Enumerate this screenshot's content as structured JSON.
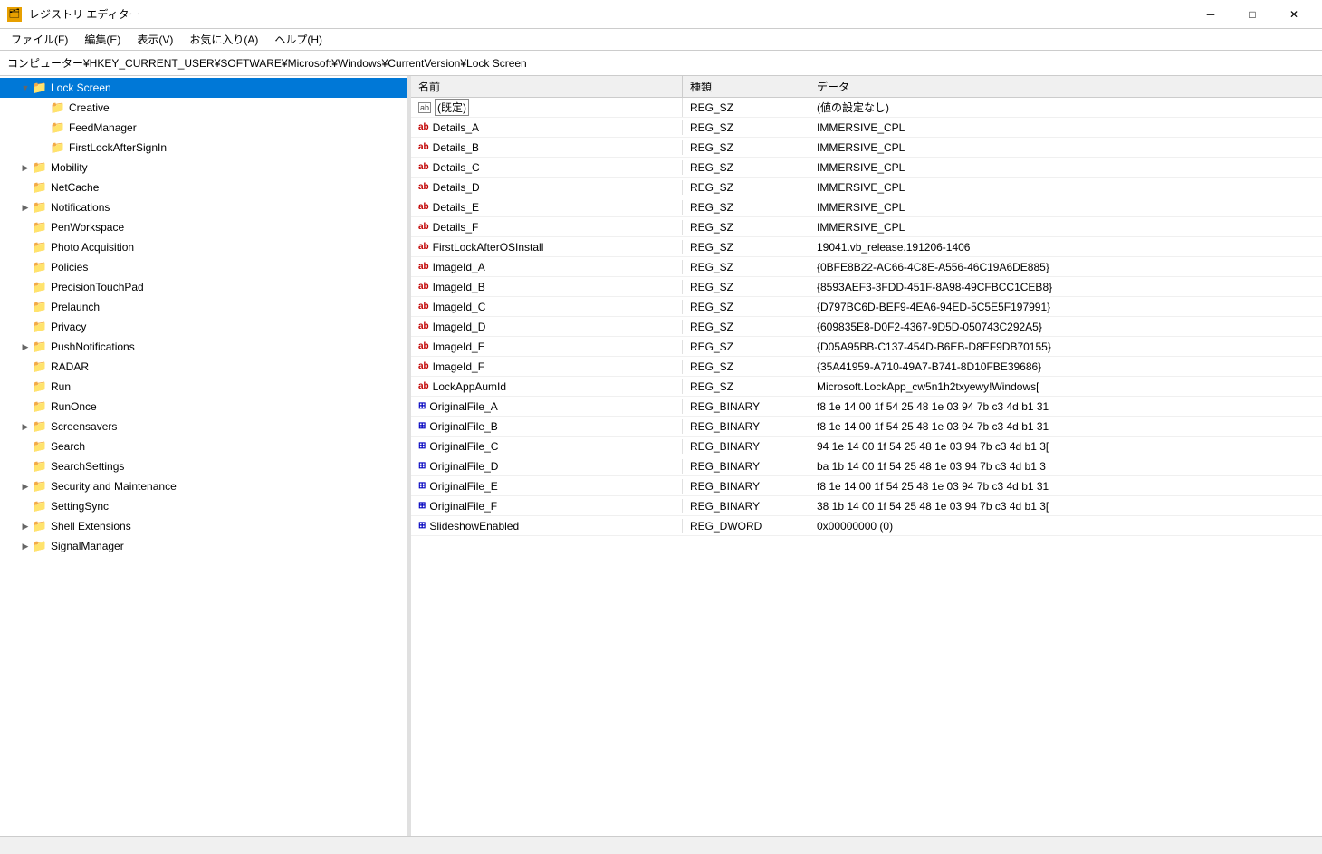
{
  "titleBar": {
    "icon": "🗂",
    "title": "レジストリ エディター",
    "minBtn": "─",
    "maxBtn": "□",
    "closeBtn": "✕"
  },
  "menuBar": {
    "items": [
      {
        "label": "ファイル(F)"
      },
      {
        "label": "編集(E)"
      },
      {
        "label": "表示(V)"
      },
      {
        "label": "お気に入り(A)"
      },
      {
        "label": "ヘルプ(H)"
      }
    ]
  },
  "addressBar": {
    "path": "コンピューター¥HKEY_CURRENT_USER¥SOFTWARE¥Microsoft¥Windows¥CurrentVersion¥Lock Screen"
  },
  "treePanel": {
    "header": "名前",
    "items": [
      {
        "label": "Lock Screen",
        "indent": 1,
        "selected": true,
        "expanded": true,
        "hasExpand": true
      },
      {
        "label": "Creative",
        "indent": 2,
        "selected": false,
        "expanded": false,
        "hasExpand": false
      },
      {
        "label": "FeedManager",
        "indent": 2,
        "selected": false,
        "expanded": false,
        "hasExpand": false
      },
      {
        "label": "FirstLockAfterSignIn",
        "indent": 2,
        "selected": false,
        "expanded": false,
        "hasExpand": false
      },
      {
        "label": "Mobility",
        "indent": 1,
        "selected": false,
        "expanded": false,
        "hasExpand": true
      },
      {
        "label": "NetCache",
        "indent": 1,
        "selected": false,
        "expanded": false,
        "hasExpand": false
      },
      {
        "label": "Notifications",
        "indent": 1,
        "selected": false,
        "expanded": false,
        "hasExpand": true
      },
      {
        "label": "PenWorkspace",
        "indent": 1,
        "selected": false,
        "expanded": false,
        "hasExpand": false
      },
      {
        "label": "Photo Acquisition",
        "indent": 1,
        "selected": false,
        "expanded": false,
        "hasExpand": false
      },
      {
        "label": "Policies",
        "indent": 1,
        "selected": false,
        "expanded": false,
        "hasExpand": false
      },
      {
        "label": "PrecisionTouchPad",
        "indent": 1,
        "selected": false,
        "expanded": false,
        "hasExpand": false
      },
      {
        "label": "Prelaunch",
        "indent": 1,
        "selected": false,
        "expanded": false,
        "hasExpand": false
      },
      {
        "label": "Privacy",
        "indent": 1,
        "selected": false,
        "expanded": false,
        "hasExpand": false
      },
      {
        "label": "PushNotifications",
        "indent": 1,
        "selected": false,
        "expanded": false,
        "hasExpand": true
      },
      {
        "label": "RADAR",
        "indent": 1,
        "selected": false,
        "expanded": false,
        "hasExpand": false
      },
      {
        "label": "Run",
        "indent": 1,
        "selected": false,
        "expanded": false,
        "hasExpand": false
      },
      {
        "label": "RunOnce",
        "indent": 1,
        "selected": false,
        "expanded": false,
        "hasExpand": false
      },
      {
        "label": "Screensavers",
        "indent": 1,
        "selected": false,
        "expanded": false,
        "hasExpand": true
      },
      {
        "label": "Search",
        "indent": 1,
        "selected": false,
        "expanded": false,
        "hasExpand": false
      },
      {
        "label": "SearchSettings",
        "indent": 1,
        "selected": false,
        "expanded": false,
        "hasExpand": false
      },
      {
        "label": "Security and Maintenance",
        "indent": 1,
        "selected": false,
        "expanded": false,
        "hasExpand": true
      },
      {
        "label": "SettingSync",
        "indent": 1,
        "selected": false,
        "expanded": false,
        "hasExpand": false
      },
      {
        "label": "Shell Extensions",
        "indent": 1,
        "selected": false,
        "expanded": false,
        "hasExpand": true
      },
      {
        "label": "SignalManager",
        "indent": 1,
        "selected": false,
        "expanded": false,
        "hasExpand": true
      }
    ]
  },
  "tableHeaders": {
    "name": "名前",
    "type": "種類",
    "data": "データ"
  },
  "tableRows": [
    {
      "name": "(既定)",
      "type": "REG_SZ",
      "data": "(値の設定なし)",
      "iconType": "default",
      "selected": false
    },
    {
      "name": "Details_A",
      "type": "REG_SZ",
      "data": "IMMERSIVE_CPL",
      "iconType": "sz",
      "selected": false
    },
    {
      "name": "Details_B",
      "type": "REG_SZ",
      "data": "IMMERSIVE_CPL",
      "iconType": "sz",
      "selected": false
    },
    {
      "name": "Details_C",
      "type": "REG_SZ",
      "data": "IMMERSIVE_CPL",
      "iconType": "sz",
      "selected": false
    },
    {
      "name": "Details_D",
      "type": "REG_SZ",
      "data": "IMMERSIVE_CPL",
      "iconType": "sz",
      "selected": false
    },
    {
      "name": "Details_E",
      "type": "REG_SZ",
      "data": "IMMERSIVE_CPL",
      "iconType": "sz",
      "selected": false
    },
    {
      "name": "Details_F",
      "type": "REG_SZ",
      "data": "IMMERSIVE_CPL",
      "iconType": "sz",
      "selected": false
    },
    {
      "name": "FirstLockAfterOSInstall",
      "type": "REG_SZ",
      "data": "19041.vb_release.191206-1406",
      "iconType": "sz",
      "selected": false
    },
    {
      "name": "ImageId_A",
      "type": "REG_SZ",
      "data": "{0BFE8B22-AC66-4C8E-A556-46C19A6DE885}",
      "iconType": "sz",
      "selected": false
    },
    {
      "name": "ImageId_B",
      "type": "REG_SZ",
      "data": "{8593AEF3-3FDD-451F-8A98-49CFBCC1CEB8}",
      "iconType": "sz",
      "selected": false
    },
    {
      "name": "ImageId_C",
      "type": "REG_SZ",
      "data": "{D797BC6D-BEF9-4EA6-94ED-5C5E5F197991}",
      "iconType": "sz",
      "selected": false
    },
    {
      "name": "ImageId_D",
      "type": "REG_SZ",
      "data": "{609835E8-D0F2-4367-9D5D-050743C292A5}",
      "iconType": "sz",
      "selected": false
    },
    {
      "name": "ImageId_E",
      "type": "REG_SZ",
      "data": "{D05A95BB-C137-454D-B6EB-D8EF9DB70155}",
      "iconType": "sz",
      "selected": false
    },
    {
      "name": "ImageId_F",
      "type": "REG_SZ",
      "data": "{35A41959-A710-49A7-B741-8D10FBE39686}",
      "iconType": "sz",
      "selected": false
    },
    {
      "name": "LockAppAumId",
      "type": "REG_SZ",
      "data": "Microsoft.LockApp_cw5n1h2txyewy!Windows[",
      "iconType": "sz",
      "selected": false
    },
    {
      "name": "OriginalFile_A",
      "type": "REG_BINARY",
      "data": "f8 1e 14 00 1f 54 25 48 1e 03 94 7b c3 4d b1 31",
      "iconType": "binary",
      "selected": false
    },
    {
      "name": "OriginalFile_B",
      "type": "REG_BINARY",
      "data": "f8 1e 14 00 1f 54 25 48 1e 03 94 7b c3 4d b1 31",
      "iconType": "binary",
      "selected": false
    },
    {
      "name": "OriginalFile_C",
      "type": "REG_BINARY",
      "data": "94 1e 14 00 1f 54 25 48 1e 03 94 7b c3 4d b1 3[",
      "iconType": "binary",
      "selected": false
    },
    {
      "name": "OriginalFile_D",
      "type": "REG_BINARY",
      "data": "ba 1b 14 00 1f 54 25 48 1e 03 94 7b c3 4d b1 3",
      "iconType": "binary",
      "selected": false
    },
    {
      "name": "OriginalFile_E",
      "type": "REG_BINARY",
      "data": "f8 1e 14 00 1f 54 25 48 1e 03 94 7b c3 4d b1 31",
      "iconType": "binary",
      "selected": false
    },
    {
      "name": "OriginalFile_F",
      "type": "REG_BINARY",
      "data": "38 1b 14 00 1f 54 25 48 1e 03 94 7b c3 4d b1 3[",
      "iconType": "binary",
      "selected": false
    },
    {
      "name": "SlideshowEnabled",
      "type": "REG_DWORD",
      "data": "0x00000000 (0)",
      "iconType": "dword",
      "selected": false
    }
  ],
  "statusBar": {
    "text": ""
  }
}
